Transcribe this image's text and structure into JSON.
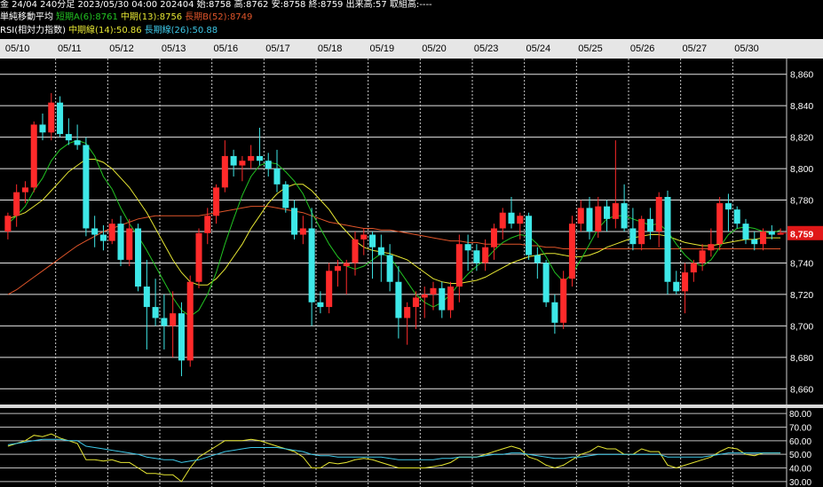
{
  "header": {
    "line1": "金 24/04 240分足 2023/05/30 04:00 202404 始:8758 高:8762 安:8758 終:8759 出来高:57 取組高:----",
    "ma_title": "単純移動平均",
    "ma_short": "短期A(6):8761",
    "ma_mid": "中期(13):8756",
    "ma_long": "長期B(52):8749",
    "rsi_title": "RSI(相対力指数)",
    "rsi_mid": "中期線(14):50.86",
    "rsi_long": "長期線(26):50.88"
  },
  "colors": {
    "up": "#ff2a2a",
    "down": "#3ee8e8",
    "ma_short": "#22c322",
    "ma_mid": "#e6e633",
    "ma_long": "#e0552a",
    "rsi_mid": "#e6e633",
    "rsi_long": "#3ec8e8",
    "price_badge": "#e01818"
  },
  "chart_data": [
    {
      "type": "candlestick",
      "title": "金 24/04 240分足",
      "categories": [
        "05/10",
        "05/11",
        "05/12",
        "05/13",
        "05/16",
        "05/17",
        "05/18",
        "05/19",
        "05/20",
        "05/23",
        "05/24",
        "05/25",
        "05/26",
        "05/27",
        "05/30"
      ],
      "y_ticks": [
        "8,860",
        "8,840",
        "8,820",
        "8,800",
        "8,780",
        "8,760",
        "8,740",
        "8,720",
        "8,700",
        "8,680",
        "8,660"
      ],
      "ylim": [
        8650,
        8870
      ],
      "last_price": "8,759",
      "candles": [
        [
          8760,
          8772,
          8755,
          8770
        ],
        [
          8770,
          8790,
          8763,
          8785
        ],
        [
          8785,
          8792,
          8778,
          8788
        ],
        [
          8788,
          8830,
          8785,
          8828
        ],
        [
          8828,
          8835,
          8818,
          8823
        ],
        [
          8823,
          8848,
          8818,
          8842
        ],
        [
          8842,
          8846,
          8820,
          8822
        ],
        [
          8822,
          8832,
          8815,
          8818
        ],
        [
          8818,
          8828,
          8812,
          8815
        ],
        [
          8815,
          8820,
          8757,
          8762
        ],
        [
          8762,
          8770,
          8750,
          8758
        ],
        [
          8758,
          8764,
          8748,
          8754
        ],
        [
          8754,
          8768,
          8752,
          8765
        ],
        [
          8765,
          8770,
          8738,
          8742
        ],
        [
          8742,
          8768,
          8738,
          8762
        ],
        [
          8762,
          8765,
          8722,
          8725
        ],
        [
          8725,
          8742,
          8685,
          8712
        ],
        [
          8712,
          8730,
          8700,
          8705
        ],
        [
          8705,
          8720,
          8685,
          8700
        ],
        [
          8700,
          8722,
          8680,
          8708
        ],
        [
          8708,
          8715,
          8668,
          8678
        ],
        [
          8678,
          8732,
          8674,
          8728
        ],
        [
          8728,
          8762,
          8724,
          8759
        ],
        [
          8759,
          8775,
          8752,
          8770
        ],
        [
          8770,
          8790,
          8765,
          8788
        ],
        [
          8788,
          8818,
          8785,
          8808
        ],
        [
          8808,
          8812,
          8795,
          8802
        ],
        [
          8802,
          8808,
          8792,
          8805
        ],
        [
          8805,
          8815,
          8800,
          8808
        ],
        [
          8808,
          8826,
          8802,
          8805
        ],
        [
          8805,
          8810,
          8795,
          8800
        ],
        [
          8800,
          8812,
          8785,
          8790
        ],
        [
          8790,
          8792,
          8772,
          8775
        ],
        [
          8775,
          8780,
          8755,
          8758
        ],
        [
          8758,
          8770,
          8752,
          8762
        ],
        [
          8762,
          8775,
          8700,
          8715
        ],
        [
          8715,
          8722,
          8708,
          8712
        ],
        [
          8712,
          8740,
          8708,
          8735
        ],
        [
          8735,
          8742,
          8725,
          8738
        ],
        [
          8738,
          8742,
          8720,
          8740
        ],
        [
          8740,
          8760,
          8732,
          8755
        ],
        [
          8755,
          8762,
          8745,
          8758
        ],
        [
          8758,
          8760,
          8730,
          8750
        ],
        [
          8750,
          8758,
          8728,
          8745
        ],
        [
          8745,
          8752,
          8722,
          8728
        ],
        [
          8728,
          8738,
          8692,
          8705
        ],
        [
          8705,
          8715,
          8688,
          8712
        ],
        [
          8712,
          8722,
          8698,
          8718
        ],
        [
          8718,
          8725,
          8705,
          8720
        ],
        [
          8720,
          8728,
          8710,
          8724
        ],
        [
          8724,
          8728,
          8705,
          8710
        ],
        [
          8710,
          8728,
          8705,
          8725
        ],
        [
          8725,
          8758,
          8715,
          8752
        ],
        [
          8752,
          8758,
          8735,
          8748
        ],
        [
          8748,
          8752,
          8735,
          8740
        ],
        [
          8740,
          8755,
          8735,
          8750
        ],
        [
          8750,
          8765,
          8742,
          8762
        ],
        [
          8762,
          8775,
          8755,
          8772
        ],
        [
          8772,
          8782,
          8762,
          8765
        ],
        [
          8765,
          8772,
          8755,
          8770
        ],
        [
          8770,
          8772,
          8742,
          8745
        ],
        [
          8745,
          8750,
          8730,
          8740
        ],
        [
          8740,
          8742,
          8712,
          8715
        ],
        [
          8715,
          8720,
          8695,
          8702
        ],
        [
          8702,
          8735,
          8698,
          8730
        ],
        [
          8730,
          8770,
          8725,
          8765
        ],
        [
          8765,
          8780,
          8760,
          8775
        ],
        [
          8775,
          8782,
          8755,
          8760
        ],
        [
          8760,
          8782,
          8756,
          8776
        ],
        [
          8776,
          8780,
          8760,
          8768
        ],
        [
          8768,
          8818,
          8762,
          8778
        ],
        [
          8778,
          8790,
          8760,
          8762
        ],
        [
          8762,
          8775,
          8748,
          8752
        ],
        [
          8752,
          8770,
          8748,
          8768
        ],
        [
          8768,
          8775,
          8755,
          8760
        ],
        [
          8760,
          8785,
          8750,
          8782
        ],
        [
          8782,
          8786,
          8720,
          8728
        ],
        [
          8728,
          8735,
          8720,
          8722
        ],
        [
          8722,
          8740,
          8708,
          8734
        ],
        [
          8734,
          8742,
          8728,
          8740
        ],
        [
          8740,
          8752,
          8735,
          8748
        ],
        [
          8748,
          8762,
          8744,
          8752
        ],
        [
          8752,
          8782,
          8748,
          8778
        ],
        [
          8778,
          8784,
          8760,
          8774
        ],
        [
          8774,
          8776,
          8762,
          8765
        ],
        [
          8765,
          8768,
          8752,
          8755
        ],
        [
          8755,
          8760,
          8748,
          8752
        ],
        [
          8752,
          8762,
          8748,
          8760
        ],
        [
          8760,
          8764,
          8755,
          8758
        ],
        [
          8758,
          8762,
          8758,
          8759
        ]
      ],
      "ma_short": [
        8765,
        8770,
        8776,
        8786,
        8794,
        8805,
        8812,
        8816,
        8818,
        8816,
        8808,
        8795,
        8787,
        8775,
        8765,
        8757,
        8748,
        8738,
        8728,
        8718,
        8710,
        8706,
        8710,
        8720,
        8734,
        8752,
        8768,
        8783,
        8795,
        8802,
        8804,
        8803,
        8798,
        8792,
        8784,
        8772,
        8762,
        8752,
        8744,
        8738,
        8736,
        8738,
        8742,
        8746,
        8744,
        8736,
        8728,
        8720,
        8715,
        8712,
        8715,
        8720,
        8727,
        8733,
        8738,
        8742,
        8748,
        8753,
        8756,
        8758,
        8757,
        8752,
        8744,
        8734,
        8728,
        8733,
        8742,
        8752,
        8762,
        8768,
        8770,
        8770,
        8768,
        8766,
        8764,
        8765,
        8760,
        8752,
        8745,
        8740,
        8738,
        8742,
        8750,
        8758,
        8762,
        8763,
        8762,
        8760,
        8759,
        8761
      ],
      "ma_mid": [
        8768,
        8770,
        8772,
        8776,
        8780,
        8786,
        8792,
        8798,
        8802,
        8806,
        8806,
        8804,
        8800,
        8794,
        8788,
        8780,
        8772,
        8762,
        8752,
        8742,
        8734,
        8728,
        8726,
        8726,
        8730,
        8736,
        8744,
        8752,
        8762,
        8770,
        8778,
        8784,
        8788,
        8790,
        8790,
        8786,
        8780,
        8774,
        8766,
        8760,
        8754,
        8750,
        8748,
        8747,
        8746,
        8744,
        8742,
        8738,
        8734,
        8730,
        8728,
        8727,
        8727,
        8728,
        8729,
        8731,
        8734,
        8737,
        8740,
        8742,
        8744,
        8745,
        8746,
        8746,
        8745,
        8744,
        8744,
        8745,
        8747,
        8750,
        8752,
        8754,
        8756,
        8757,
        8758,
        8758,
        8757,
        8755,
        8753,
        8752,
        8751,
        8751,
        8752,
        8753,
        8754,
        8755,
        8755,
        8756,
        8756,
        8756
      ],
      "ma_long": [
        8720,
        8723,
        8727,
        8731,
        8735,
        8739,
        8743,
        8747,
        8751,
        8754,
        8757,
        8760,
        8762,
        8764,
        8766,
        8768,
        8769,
        8770,
        8770,
        8770,
        8770,
        8770,
        8770,
        8771,
        8772,
        8773,
        8774,
        8775,
        8776,
        8776,
        8776,
        8775,
        8774,
        8773,
        8772,
        8770,
        8768,
        8766,
        8765,
        8764,
        8763,
        8762,
        8762,
        8761,
        8761,
        8760,
        8759,
        8758,
        8757,
        8756,
        8755,
        8754,
        8754,
        8753,
        8753,
        8752,
        8752,
        8752,
        8752,
        8752,
        8751,
        8751,
        8750,
        8750,
        8749,
        8749,
        8749,
        8749,
        8749,
        8749,
        8749,
        8749,
        8749,
        8749,
        8749,
        8749,
        8749,
        8749,
        8749,
        8749,
        8749,
        8749,
        8749,
        8749,
        8749,
        8749,
        8749,
        8749,
        8749,
        8749
      ]
    },
    {
      "type": "line",
      "title": "RSI(相対力指数)",
      "y_ticks": [
        "80.00",
        "70.00",
        "60.00",
        "50.00",
        "40.00",
        "30.00"
      ],
      "ylim": [
        26,
        84
      ],
      "series": [
        {
          "name": "中期線(14)",
          "values": [
            56,
            58,
            60,
            64,
            63,
            65,
            62,
            60,
            58,
            46,
            46,
            45,
            46,
            44,
            44,
            40,
            36,
            36,
            35,
            35,
            30,
            40,
            48,
            52,
            56,
            60,
            60,
            60,
            61,
            60,
            58,
            56,
            54,
            52,
            48,
            40,
            40,
            44,
            43,
            44,
            46,
            47,
            46,
            44,
            42,
            40,
            40,
            40,
            40,
            41,
            42,
            44,
            48,
            48,
            48,
            50,
            52,
            54,
            56,
            54,
            48,
            46,
            42,
            40,
            42,
            46,
            50,
            52,
            56,
            54,
            54,
            50,
            50,
            54,
            52,
            52,
            42,
            40,
            42,
            44,
            46,
            48,
            52,
            55,
            54,
            50,
            49,
            51,
            51,
            51
          ]
        },
        {
          "name": "長期線(26)",
          "values": [
            57,
            58,
            59,
            60,
            61,
            61,
            61,
            60,
            60,
            56,
            55,
            54,
            53,
            52,
            51,
            50,
            48,
            47,
            46,
            46,
            44,
            45,
            46,
            48,
            50,
            52,
            53,
            54,
            55,
            55,
            55,
            55,
            54,
            53,
            52,
            50,
            49,
            49,
            48,
            48,
            48,
            48,
            48,
            48,
            47,
            46,
            46,
            46,
            46,
            46,
            47,
            47,
            48,
            48,
            48,
            49,
            50,
            50,
            51,
            51,
            50,
            49,
            48,
            47,
            47,
            48,
            48,
            49,
            50,
            50,
            50,
            50,
            50,
            50,
            50,
            50,
            48,
            48,
            48,
            48,
            48,
            49,
            50,
            51,
            51,
            51,
            51,
            51,
            51,
            51
          ]
        }
      ]
    }
  ]
}
